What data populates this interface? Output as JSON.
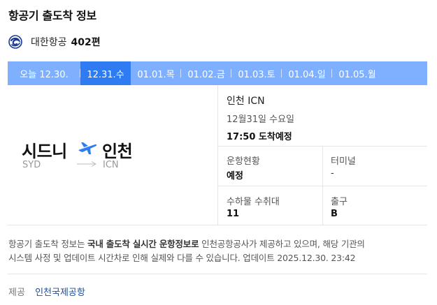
{
  "title": "항공기 출도착 정보",
  "airline": {
    "name": "대한항공",
    "flight": "402편"
  },
  "date_tabs": [
    {
      "label": "오늘 12.30.",
      "active": false
    },
    {
      "label": "12.31.수",
      "active": true
    },
    {
      "label": "01.01.목",
      "active": false
    },
    {
      "label": "01.02.금",
      "active": false
    },
    {
      "label": "01.03.토",
      "active": false
    },
    {
      "label": "01.04.일",
      "active": false
    },
    {
      "label": "01.05.월",
      "active": false
    }
  ],
  "route": {
    "origin_name": "시드니",
    "origin_code": "SYD",
    "dest_name": "인천",
    "dest_code": "ICN"
  },
  "arrival": {
    "airport": "인천 ICN",
    "date": "12월31일 수요일",
    "time": "17:50 도착예정"
  },
  "info": {
    "status_label": "운항현황",
    "status_value": "예정",
    "terminal_label": "터미널",
    "terminal_value": "-",
    "baggage_label": "수하물 수취대",
    "baggage_value": "11",
    "gate_label": "출구",
    "gate_value": "B"
  },
  "notice": {
    "part1": "항공기 출도착 정보는 ",
    "bold": "국내 출도착 실시간 운항정보로",
    "part2": " 인천공항공사가 제공하고 있으며, 해당 기관의",
    "line2": "시스템 사정 및 업데이트 시간차로 인해 실제와 다를 수 있습니다. 업데이트 2025.12.30. 23:42"
  },
  "footer": {
    "label": "제공",
    "source": "인천국제공항"
  },
  "colors": {
    "tab_bg": "#7fb0ff",
    "tab_active": "#2e7bf2",
    "plane": "#2e7bf2",
    "link": "#1a4fa3"
  },
  "icons": {
    "airline_logo": "korean-air-logo",
    "plane": "airplane-icon",
    "arrow": "route-arrow"
  }
}
